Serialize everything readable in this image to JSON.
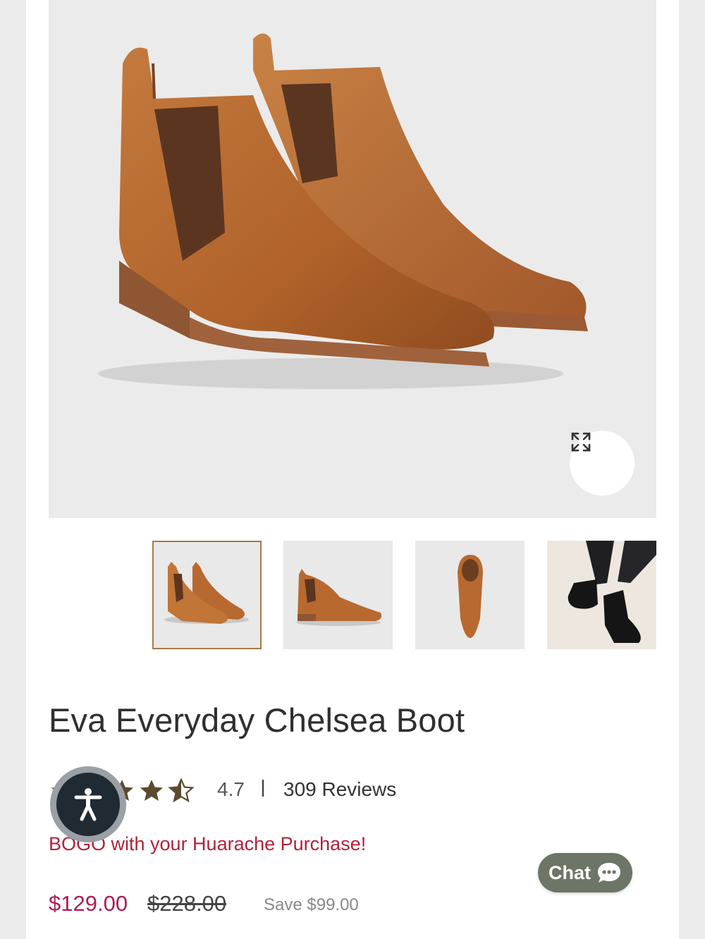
{
  "gallery": {
    "main_image_alt": "Eva Everyday Chelsea Boot",
    "expand_icon": "expand-arrows-icon",
    "thumbnails": [
      {
        "alt": "Pair of cognac boots, angled view",
        "active": true
      },
      {
        "alt": "Single cognac boot, side view",
        "active": false
      },
      {
        "alt": "Cognac boot, top view",
        "active": false
      },
      {
        "alt": "Black boots worn on model",
        "active": false
      }
    ]
  },
  "product": {
    "title": "Eva Everyday Chelsea Boot",
    "rating": "4.7",
    "rating_stars": 4.5,
    "reviews": "309 Reviews",
    "promo": "BOGO with your Huarache Purchase!",
    "price": "$129.00",
    "compare_price": "$228.00",
    "savings": "Save $99.00"
  },
  "widgets": {
    "accessibility_icon": "accessibility-person-icon",
    "chat_label": "Chat",
    "chat_icon": "chat-bubble-icon"
  },
  "colors": {
    "price": "#b01c55",
    "promo": "#b3213a",
    "star": "#5c4a2e",
    "chat_bg": "#6d7566",
    "leather": "#b8692f"
  }
}
